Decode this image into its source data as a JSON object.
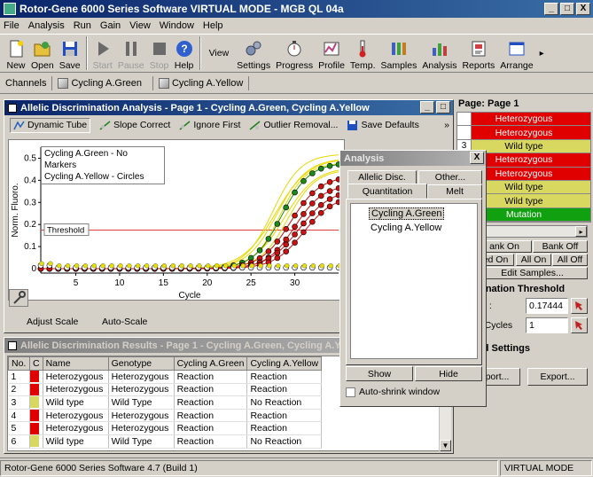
{
  "app": {
    "title": "Rotor-Gene 6000 Series Software VIRTUAL MODE - MGB QL 04a",
    "window_controls": [
      "_",
      "□",
      "X"
    ]
  },
  "menu": [
    "File",
    "Analysis",
    "Run",
    "Gain",
    "View",
    "Window",
    "Help"
  ],
  "toolbar": {
    "left": [
      {
        "label": "New",
        "icon": "new-file-icon",
        "enabled": true
      },
      {
        "label": "Open",
        "icon": "open-folder-icon",
        "enabled": true
      },
      {
        "label": "Save",
        "icon": "save-disk-icon",
        "enabled": true
      },
      {
        "label": "Start",
        "icon": "play-icon",
        "enabled": false
      },
      {
        "label": "Pause",
        "icon": "pause-icon",
        "enabled": false
      },
      {
        "label": "Stop",
        "icon": "stop-icon",
        "enabled": false
      },
      {
        "label": "Help",
        "icon": "help-icon",
        "enabled": true
      }
    ],
    "view_label": "View",
    "right": [
      {
        "label": "Settings",
        "icon": "gears-icon"
      },
      {
        "label": "Progress",
        "icon": "stopwatch-icon"
      },
      {
        "label": "Profile",
        "icon": "profile-icon"
      },
      {
        "label": "Temp.",
        "icon": "thermometer-icon"
      },
      {
        "label": "Samples",
        "icon": "samples-icon"
      },
      {
        "label": "Analysis",
        "icon": "analysis-icon"
      },
      {
        "label": "Reports",
        "icon": "reports-icon"
      },
      {
        "label": "Arrange",
        "icon": "arrange-icon"
      }
    ]
  },
  "channels": {
    "label": "Channels",
    "tabs": [
      "Cycling A.Green",
      "Cycling A.Yellow"
    ]
  },
  "analysis_window": {
    "title": "Allelic Discrimination Analysis - Page 1 - Cycling A.Green, Cycling A.Yellow",
    "tools": [
      "Dynamic Tube",
      "Slope Correct",
      "Ignore First",
      "Outlier Removal...",
      "Save Defaults"
    ],
    "legend": [
      "Cycling A.Green - No Markers",
      "Cycling A.Yellow - Circles"
    ],
    "threshold_label": "Threshold",
    "adjust_scale": "Adjust Scale",
    "auto_scale": "Auto-Scale"
  },
  "chart_data": {
    "type": "line",
    "xlabel": "Cycle",
    "ylabel": "Norm. Fluoro.",
    "x_ticks": [
      5,
      10,
      15,
      20,
      25,
      30
    ],
    "y_ticks": [
      0,
      0.1,
      0.2,
      0.3,
      0.4,
      0.5
    ],
    "xlim": [
      1,
      35
    ],
    "ylim": [
      -0.02,
      0.55
    ],
    "threshold": 0.17444,
    "series_colors": {
      "green_channel": "#e8d800",
      "marker_red": "#cc1111",
      "marker_green": "#1a8a1a",
      "marker_yellow": "#e8e000"
    }
  },
  "results_window": {
    "title": "Allelic Discrimination Results - Page 1 - Cycling A.Green, Cycling A.Yellow",
    "columns": [
      "No.",
      "C",
      "Name",
      "Genotype",
      "Cycling A.Green",
      "Cycling A.Yellow"
    ],
    "rows": [
      {
        "no": "1",
        "color": "#e00000",
        "name": "Heterozygous",
        "genotype": "Heterozygous",
        "green": "Reaction",
        "yellow": "Reaction"
      },
      {
        "no": "2",
        "color": "#e00000",
        "name": "Heterozygous",
        "genotype": "Heterozygous",
        "green": "Reaction",
        "yellow": "Reaction"
      },
      {
        "no": "3",
        "color": "#d8d860",
        "name": "Wild type",
        "genotype": "Wild Type",
        "green": "Reaction",
        "yellow": "No Reaction"
      },
      {
        "no": "4",
        "color": "#e00000",
        "name": "Heterozygous",
        "genotype": "Heterozygous",
        "green": "Reaction",
        "yellow": "Reaction"
      },
      {
        "no": "5",
        "color": "#e00000",
        "name": "Heterozygous",
        "genotype": "Heterozygous",
        "green": "Reaction",
        "yellow": "Reaction"
      },
      {
        "no": "6",
        "color": "#d8d860",
        "name": "Wild type",
        "genotype": "Wild Type",
        "green": "Reaction",
        "yellow": "No Reaction"
      }
    ]
  },
  "analysis_popup": {
    "title": "Analysis",
    "tabs_row1": [
      "Allelic Disc.",
      "Other..."
    ],
    "tabs_row2": [
      "Quantitation",
      "Melt"
    ],
    "items": [
      "Cycling A.Green",
      "Cycling A.Yellow"
    ],
    "show": "Show",
    "hide": "Hide",
    "auto_shrink": "Auto-shrink window"
  },
  "right_panel": {
    "page_label": "Page: Page 1",
    "genotypes": [
      {
        "num": "1",
        "label": "Heterozygous",
        "color": "#e00000"
      },
      {
        "num": "2",
        "label": "Heterozygous",
        "color": "#e00000"
      },
      {
        "num": "3",
        "label": "Wild type",
        "color": "#d8d860"
      },
      {
        "num": "",
        "label": "Heterozygous",
        "color": "#e00000"
      },
      {
        "num": "",
        "label": "Heterozygous",
        "color": "#e00000"
      },
      {
        "num": "",
        "label": "Wild type",
        "color": "#d8d860"
      },
      {
        "num": "",
        "label": "Wild type",
        "color": "#d8d860"
      },
      {
        "num": "",
        "label": "Mutation",
        "color": "#10a010"
      }
    ],
    "bank_on": "ank On",
    "bank_off": "Bank Off",
    "sel_on": "ed On",
    "all_on": "All On",
    "all_off": "All Off",
    "edit_samples": "Edit Samples...",
    "threshold_title": "mination Threshold",
    "threshold_label": "old :",
    "threshold_value": "0.17444",
    "cycles_label": "te Cycles",
    "cycles_value": "1",
    "settings_title": "ted Settings",
    "import": "port...",
    "export": "Export..."
  },
  "status": {
    "left": "Rotor-Gene 6000 Series Software 4.7 (Build 1)",
    "right": "VIRTUAL MODE"
  }
}
